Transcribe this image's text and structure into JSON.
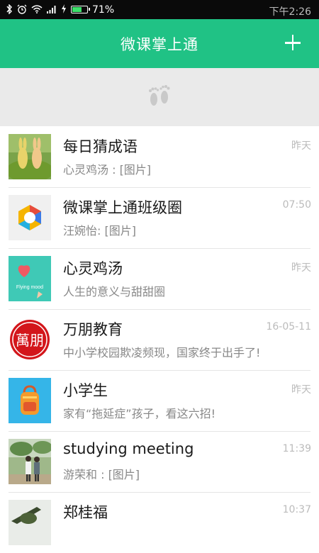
{
  "status_bar": {
    "time": "下午2:26",
    "battery": "71%",
    "battery_level": 0.71,
    "icons": [
      "bluetooth-icon",
      "alarm-icon",
      "wifi-icon",
      "signal-icon",
      "charging-icon",
      "battery-icon"
    ]
  },
  "header": {
    "title": "微课掌上通",
    "action_icon": "plus-icon"
  },
  "conversations": [
    {
      "name": "每日猜成语",
      "preview": "心灵鸡汤 : [图片]",
      "time": "昨天"
    },
    {
      "name": "微课掌上通班级圈",
      "preview": "汪婉怡: [图片]",
      "time": "07:50"
    },
    {
      "name": "心灵鸡汤",
      "preview": "人生的意义与甜甜圈",
      "time": "昨天",
      "avatar_text": "Flying mood"
    },
    {
      "name": "万朋教育",
      "preview": "中小学校园欺凌频现，国家终于出手了!",
      "time": "16-05-11",
      "avatar_text": "萬朋"
    },
    {
      "name": "小学生",
      "preview": "家有“拖延症”孩子，看这六招!",
      "time": "昨天"
    },
    {
      "name": "studying meeting",
      "preview": "游荣和 : [图片]",
      "time": "11:39"
    },
    {
      "name": "郑桂福",
      "preview": "",
      "time": "10:37"
    }
  ],
  "colors": {
    "accent": "#20c285",
    "status_bar": "#0a0a0a"
  }
}
